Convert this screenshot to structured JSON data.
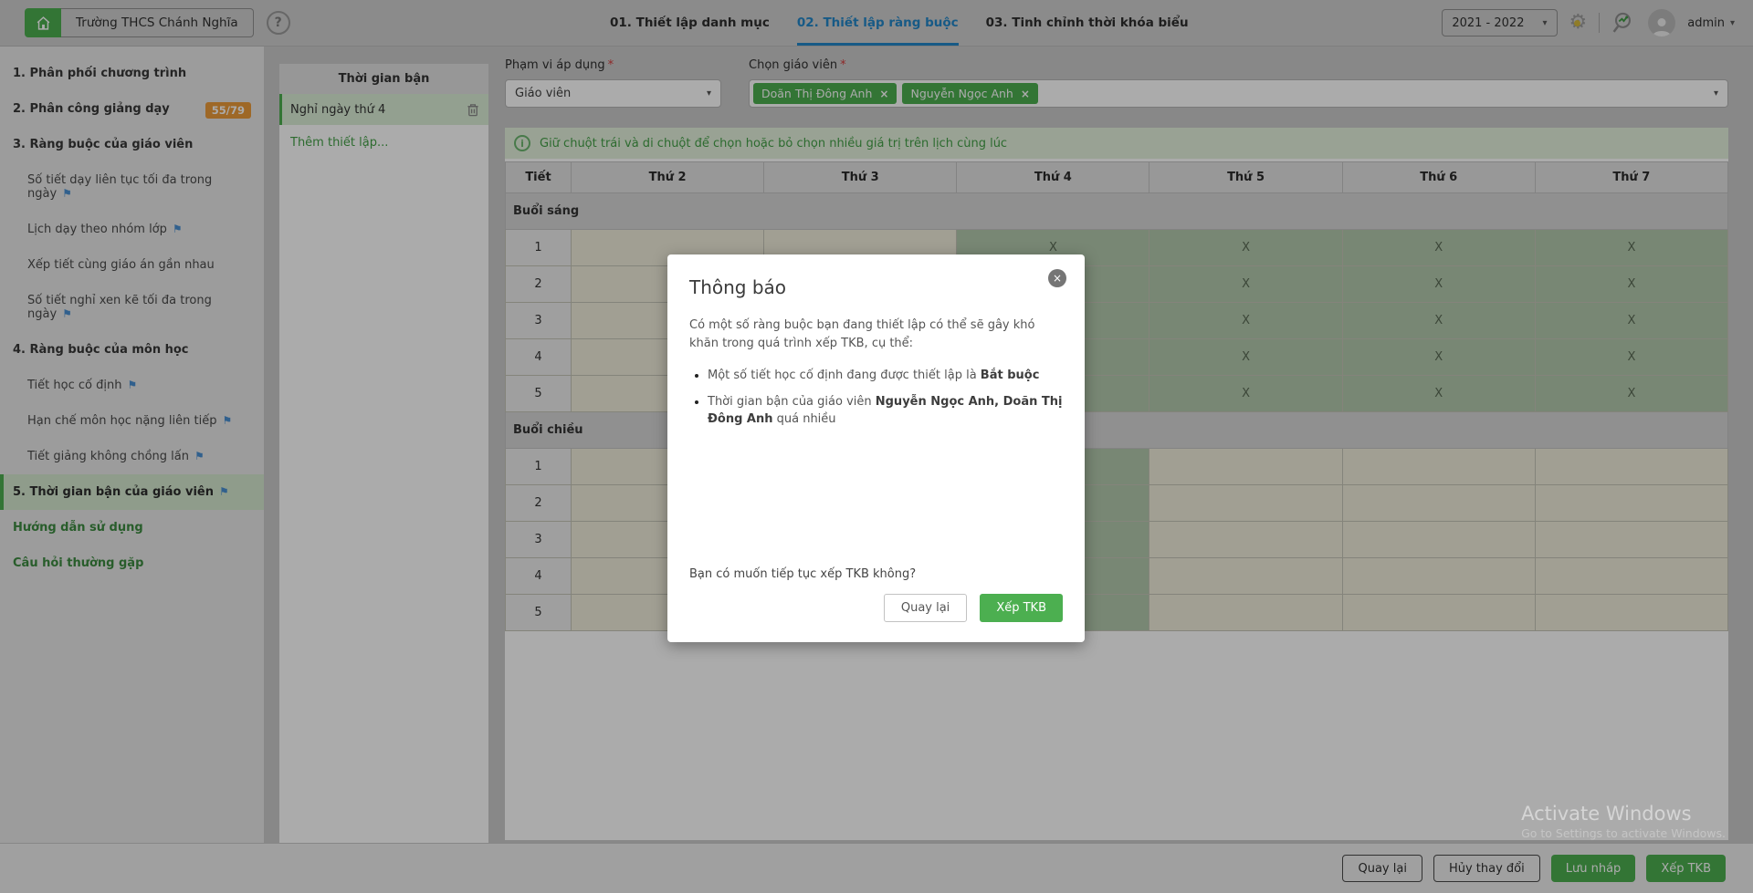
{
  "colors": {
    "accent_green": "#4caf50",
    "tab_blue": "#2386c8",
    "flag_blue": "#4a90d2",
    "badge_orange": "#ec9b3b",
    "busy_cell": "#b4c9ad",
    "free_cell": "#f0eedb"
  },
  "header": {
    "school_name": "Trường THCS Chánh Nghĩa",
    "help_label": "?",
    "tabs": [
      {
        "label": "01. Thiết lập danh mục"
      },
      {
        "label": "02. Thiết lập ràng buộc"
      },
      {
        "label": "03. Tinh chỉnh thời khóa biểu"
      }
    ],
    "year_value": "2021 - 2022",
    "user_name": "admin"
  },
  "sidebar": {
    "items": [
      {
        "label": "1. Phân phối chương trình"
      },
      {
        "label": "2. Phân công giảng dạy",
        "badge": "55/79"
      },
      {
        "label": "3. Ràng buộc của giáo viên"
      },
      {
        "label": "Số tiết dạy liên tục tối đa trong ngày"
      },
      {
        "label": "Lịch dạy theo nhóm lớp"
      },
      {
        "label": "Xếp tiết cùng giáo án gần nhau"
      },
      {
        "label": "Số tiết nghỉ xen kẽ tối đa trong ngày"
      },
      {
        "label": "4. Ràng buộc của môn học"
      },
      {
        "label": "Tiết học cố định"
      },
      {
        "label": "Hạn chế môn học nặng liên tiếp"
      },
      {
        "label": "Tiết giảng không chồng lấn"
      },
      {
        "label": "5. Thời gian bận của giáo viên"
      },
      {
        "label": "Hướng dẫn sử dụng"
      },
      {
        "label": "Câu hỏi thường gặp"
      }
    ]
  },
  "panel": {
    "title": "Thời gian bận",
    "items": [
      {
        "label": "Nghỉ ngày thứ 4"
      }
    ],
    "add_label": "Thêm thiết lập..."
  },
  "form": {
    "scope_label": "Phạm vi áp dụng",
    "scope_value": "Giáo viên",
    "teacher_label": "Chọn giáo viên",
    "teacher_tags": [
      "Doãn Thị Đông Anh",
      "Nguyễn Ngọc Anh"
    ]
  },
  "info_bar": {
    "text": "Giữ chuột trái và di chuột để chọn hoặc bỏ chọn nhiều giá trị trên lịch cùng lúc",
    "icon": "i"
  },
  "timetable": {
    "columns": [
      "Tiết",
      "Thứ 2",
      "Thứ 3",
      "Thứ 4",
      "Thứ 5",
      "Thứ 6",
      "Thứ 7"
    ],
    "busy_marker": "X",
    "sections": [
      {
        "name": "Buổi sáng",
        "rows": [
          {
            "period": "1",
            "days": [
              0,
              0,
              1,
              1,
              1,
              1
            ]
          },
          {
            "period": "2",
            "days": [
              0,
              0,
              1,
              1,
              1,
              1
            ]
          },
          {
            "period": "3",
            "days": [
              0,
              0,
              1,
              1,
              1,
              1
            ]
          },
          {
            "period": "4",
            "days": [
              0,
              0,
              1,
              1,
              1,
              1
            ]
          },
          {
            "period": "5",
            "days": [
              0,
              0,
              1,
              1,
              1,
              1
            ]
          }
        ]
      },
      {
        "name": "Buổi chiều",
        "rows": [
          {
            "period": "1",
            "days": [
              0,
              0,
              1,
              0,
              0,
              0
            ]
          },
          {
            "period": "2",
            "days": [
              0,
              0,
              1,
              0,
              0,
              0
            ]
          },
          {
            "period": "3",
            "days": [
              0,
              0,
              1,
              0,
              0,
              0
            ]
          },
          {
            "period": "4",
            "days": [
              0,
              0,
              1,
              0,
              0,
              0
            ]
          },
          {
            "period": "5",
            "days": [
              0,
              0,
              1,
              0,
              0,
              0
            ]
          }
        ]
      }
    ]
  },
  "modal": {
    "title": "Thông báo",
    "paragraph": "Có một số ràng buộc bạn đang thiết lập có thể sẽ gây khó khăn trong quá trình xếp TKB, cụ thể:",
    "bullets": [
      {
        "pre": "Một số tiết học cố định đang được thiết lập là ",
        "bold": "Bắt buộc",
        "post": ""
      },
      {
        "pre": "Thời gian bận của giáo viên ",
        "bold": "Nguyễn Ngọc Anh, Doãn Thị Đông Anh",
        "post": " quá nhiều"
      }
    ],
    "question": "Bạn có muốn tiếp tục xếp TKB không?",
    "back_label": "Quay lại",
    "confirm_label": "Xếp TKB",
    "close_label": "×"
  },
  "footer": {
    "buttons": [
      "Quay lại",
      "Hủy thay đổi",
      "Lưu nháp",
      "Xếp TKB"
    ]
  },
  "watermark": {
    "line1": "Activate Windows",
    "line2": "Go to Settings to activate Windows."
  }
}
